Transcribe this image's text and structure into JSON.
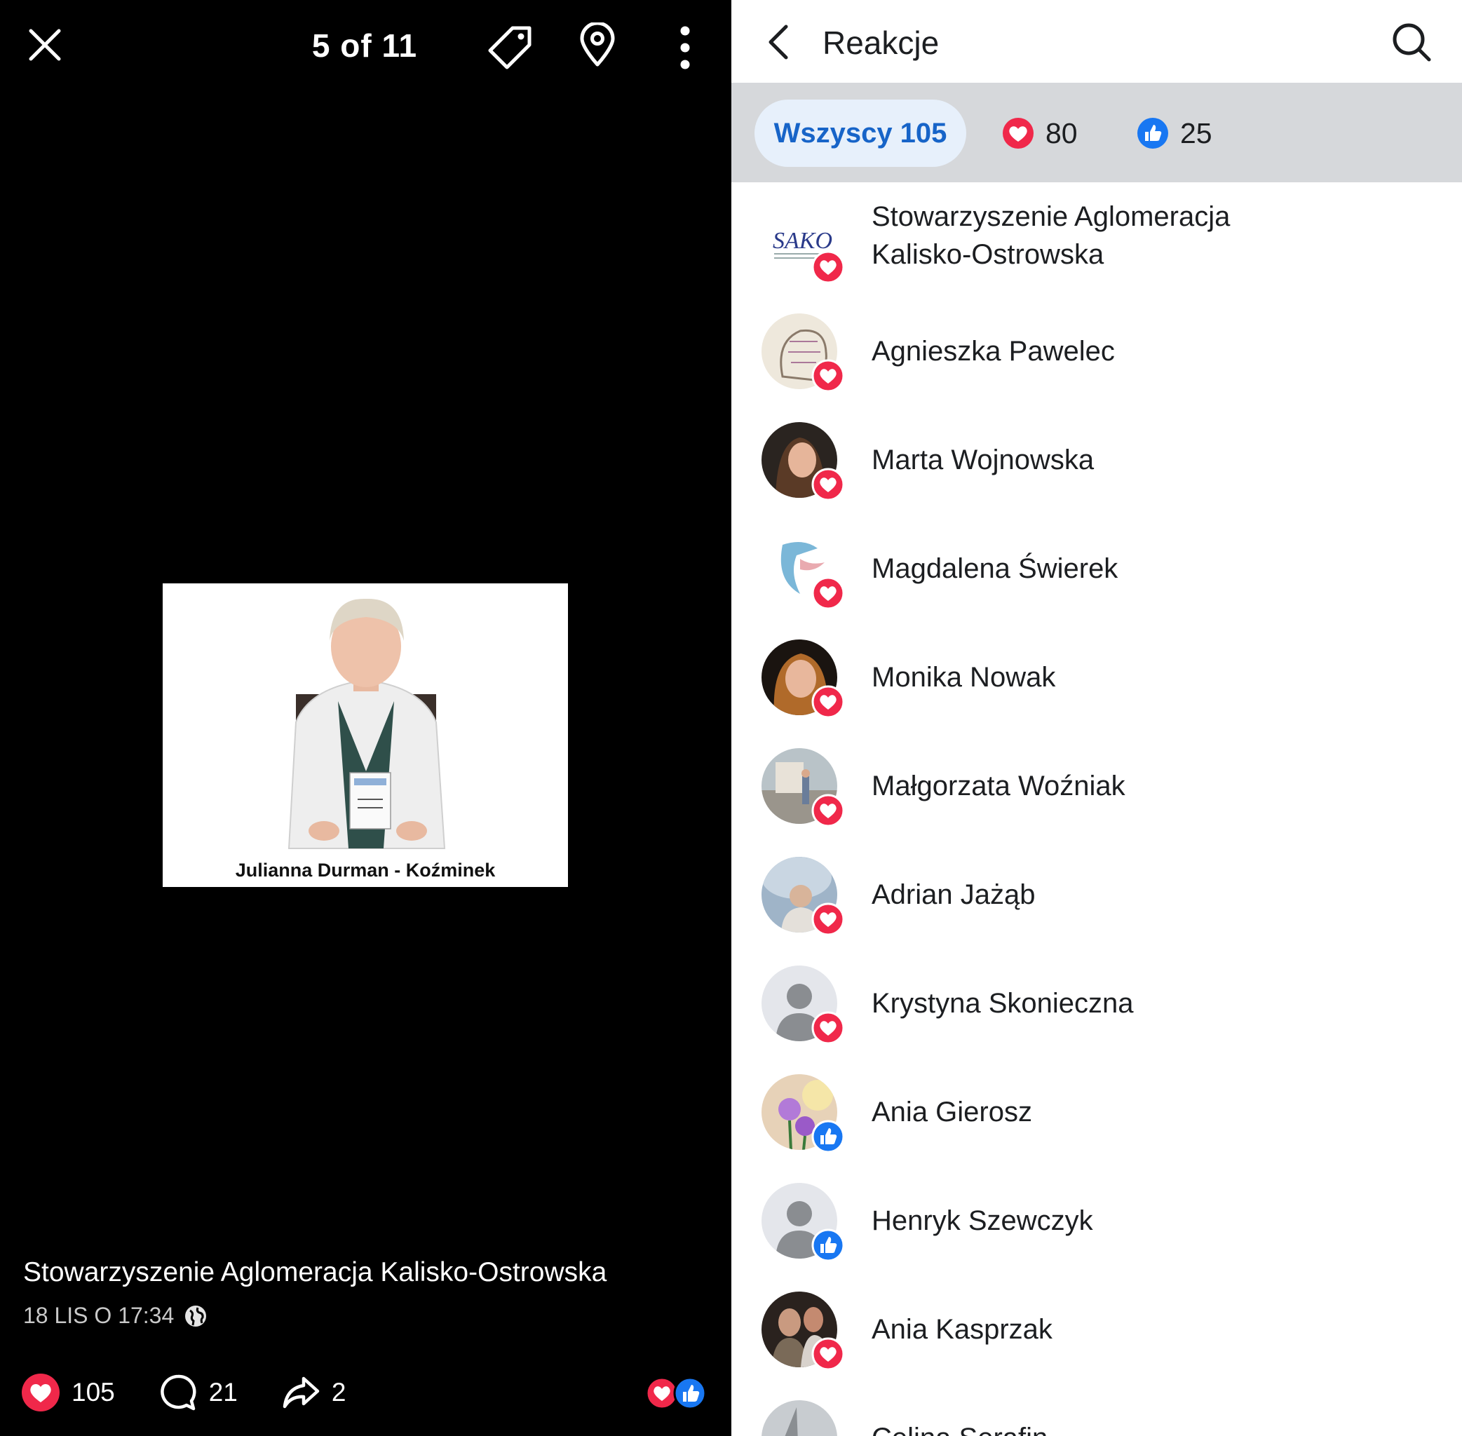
{
  "viewer": {
    "counter": "5 of 11",
    "photo_caption": "Julianna Durman - Koźminek",
    "post_author": "Stowarzyszenie Aglomeracja Kalisko-Ostrowska",
    "post_time": "18 LIS O 17:34",
    "reactions_count": "105",
    "comments_count": "21",
    "shares_count": "2"
  },
  "panel": {
    "title": "Reakcje",
    "tabs": {
      "all": "Wszyscy 105",
      "love": "80",
      "like": "25"
    },
    "people": [
      {
        "name": "Stowarzyszenie Aglomeracja Kalisko-Ostrowska",
        "reaction": "love"
      },
      {
        "name": "Agnieszka Pawelec",
        "reaction": "love"
      },
      {
        "name": "Marta Wojnowska",
        "reaction": "love"
      },
      {
        "name": "Magdalena Świerek",
        "reaction": "love"
      },
      {
        "name": "Monika Nowak",
        "reaction": "love"
      },
      {
        "name": "Małgorzata Woźniak",
        "reaction": "love"
      },
      {
        "name": "Adrian Jażąb",
        "reaction": "love"
      },
      {
        "name": "Krystyna Skonieczna",
        "reaction": "love"
      },
      {
        "name": "Ania Gierosz",
        "reaction": "like"
      },
      {
        "name": "Henryk Szewczyk",
        "reaction": "like"
      },
      {
        "name": "Ania Kasprzak",
        "reaction": "love"
      },
      {
        "name": "Celina Serafin",
        "reaction": "love"
      }
    ]
  },
  "colors": {
    "love": "#f0284a",
    "like": "#1877f2",
    "tab_active_text": "#1764c8",
    "tab_bar": "#d6d8db"
  },
  "icons": [
    "close-icon",
    "tag-icon",
    "location-pin-icon",
    "more-vertical-icon",
    "globe-icon",
    "heart-icon",
    "comment-icon",
    "share-icon",
    "back-arrow-icon",
    "search-icon",
    "like-icon"
  ]
}
